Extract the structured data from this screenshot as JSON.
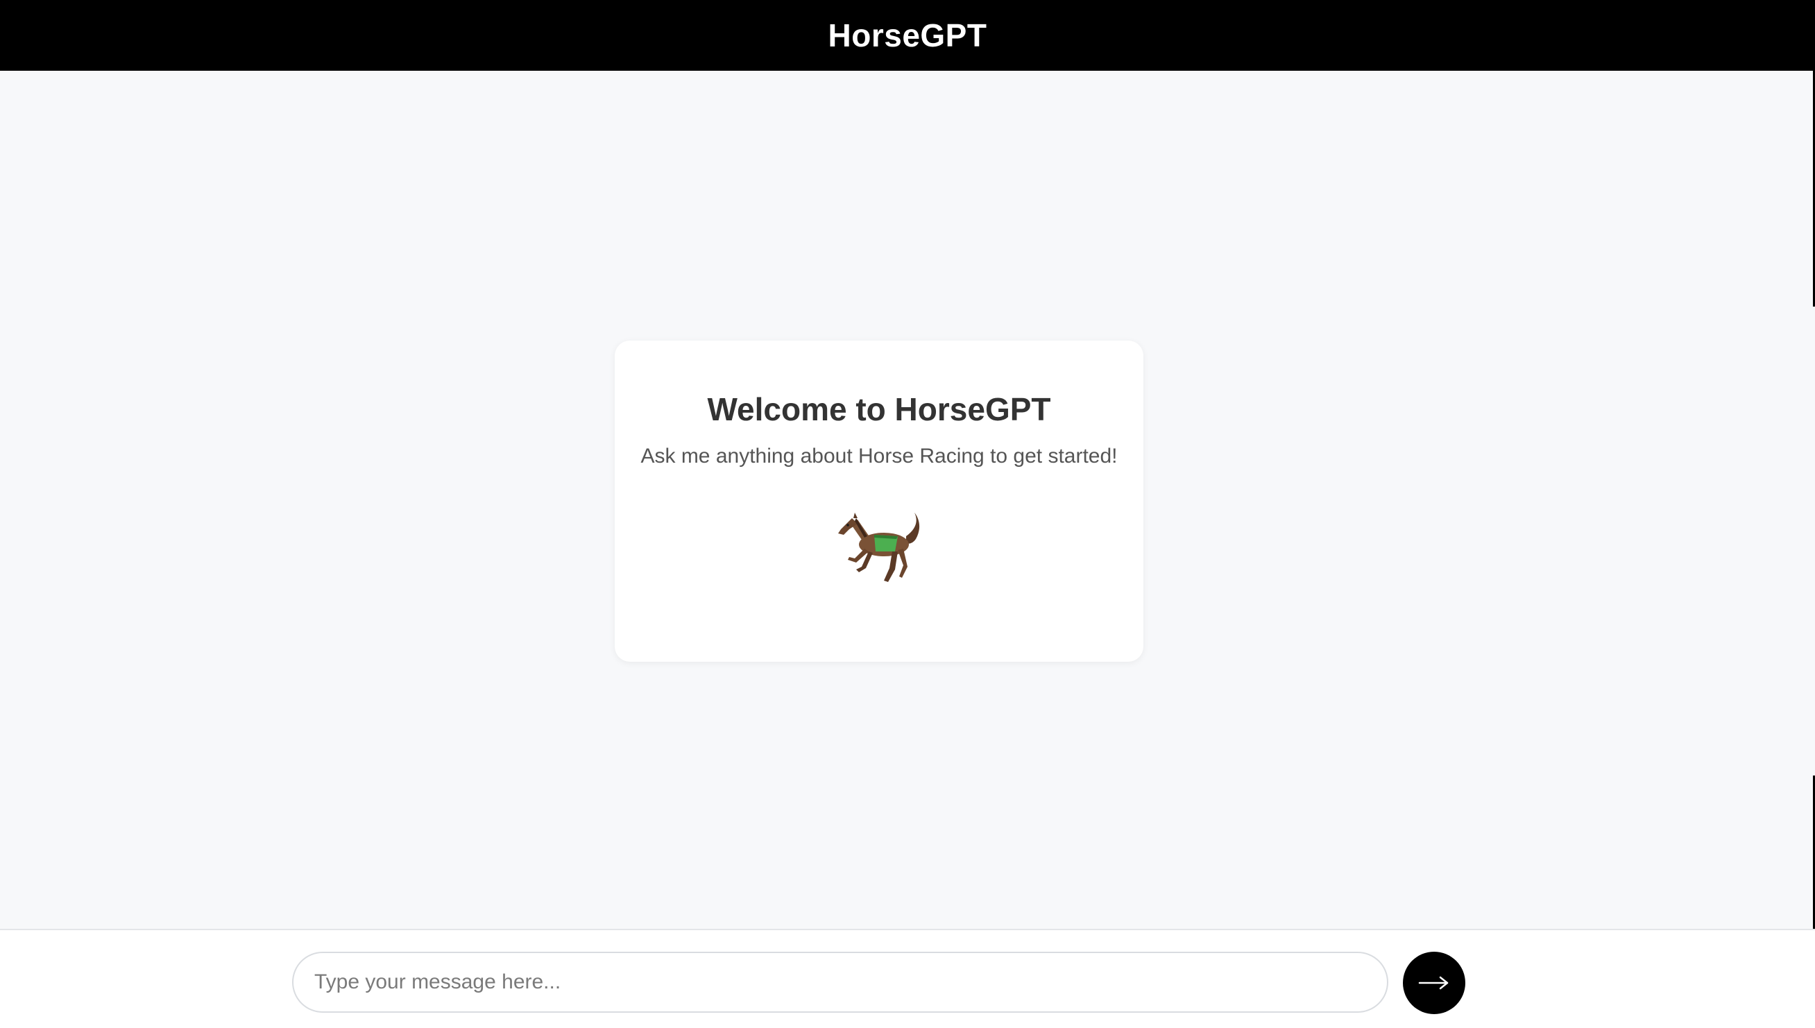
{
  "header": {
    "title": "HorseGPT"
  },
  "welcome": {
    "title": "Welcome to HorseGPT",
    "subtitle": "Ask me anything about Horse Racing to get started!",
    "icon": "racing-horse-icon"
  },
  "composer": {
    "placeholder": "Type your message here...",
    "value": "",
    "send_icon": "arrow-right-icon"
  },
  "colors": {
    "header_bg": "#000000",
    "page_bg": "#f7f8fa",
    "card_bg": "#ffffff",
    "send_button_bg": "#000000"
  }
}
